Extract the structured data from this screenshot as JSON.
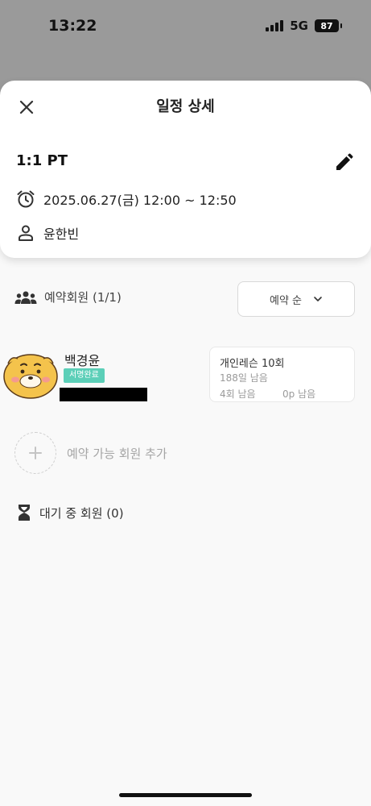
{
  "status_bar": {
    "time": "13:22",
    "network": "5G",
    "battery": "87"
  },
  "sheet": {
    "title": "일정 상세",
    "close_icon": "close-icon",
    "edit_icon": "pencil-icon"
  },
  "schedule": {
    "lesson_name": "1:1 PT",
    "datetime": "2025.06.27(금) 12:00 ~ 12:50",
    "instructor": "윤한빈"
  },
  "members": {
    "header": "예약회원 (1/1)",
    "sort_label": "예약 순",
    "list": [
      {
        "name": "백경윤",
        "badge": "서명완료",
        "pass_name": "개인레슨 10회",
        "pass_days_left": "188일 남음",
        "pass_count_left": "4회 남음",
        "pass_points_left": "0p 남음"
      }
    ],
    "add_label": "예약 가능 회원 추가"
  },
  "waitlist": {
    "label": "대기 중 회원 (0)"
  },
  "colors": {
    "badge": "#5ccfb8",
    "overlay": "#9a9a9a"
  }
}
